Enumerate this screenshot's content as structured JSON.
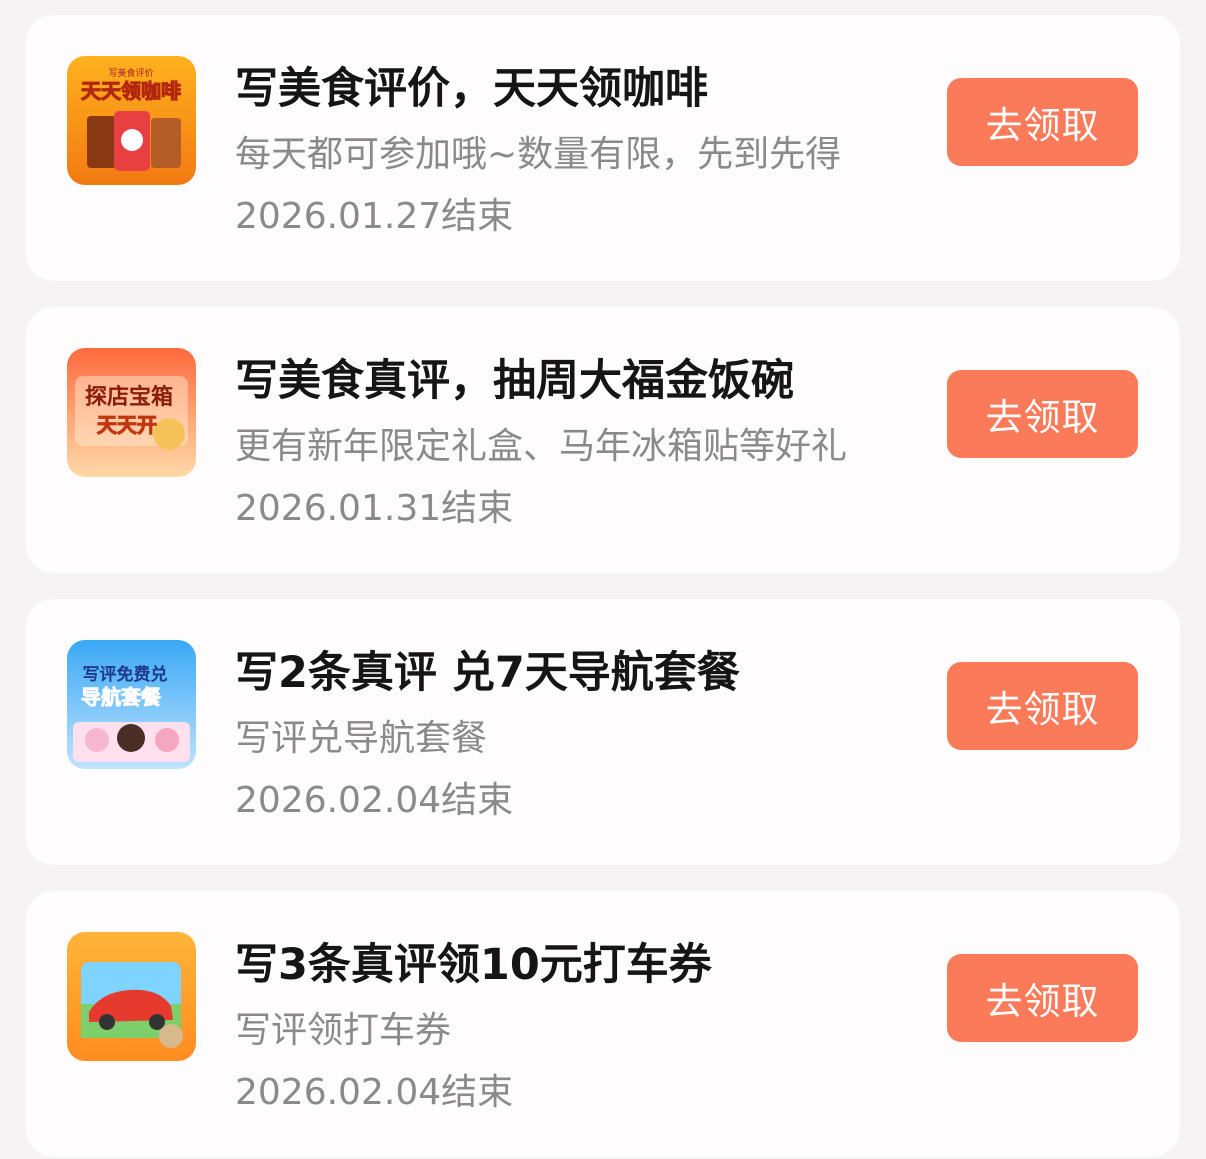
{
  "accent_color": "#fb7a5a",
  "tasks": [
    {
      "thumb_icon": "coffee-promo-thumbnail",
      "thumb_text": "天天领咖啡",
      "thumb_small": "写美食评价",
      "title": "写美食评价，天天领咖啡",
      "subtitle": "每天都可参加哦~数量有限，先到先得",
      "date": "2026.01.27结束",
      "button": "去领取"
    },
    {
      "thumb_icon": "treasure-box-thumbnail",
      "thumb_text": "探店宝箱",
      "thumb_text2": "天天开",
      "title": "写美食真评，抽周大福金饭碗",
      "subtitle": "更有新年限定礼盒、马年冰箱贴等好礼",
      "date": "2026.01.31结束",
      "button": "去领取"
    },
    {
      "thumb_icon": "navigation-package-thumbnail",
      "thumb_text": "写评免费兑",
      "thumb_text2": "导航套餐",
      "title": "写2条真评 兑7天导航套餐",
      "subtitle": "写评兑导航套餐",
      "date": "2026.02.04结束",
      "button": "去领取"
    },
    {
      "thumb_icon": "car-coupon-thumbnail",
      "title": "写3条真评领10元打车券",
      "subtitle": "写评领打车券",
      "date": "2026.02.04结束",
      "button": "去领取"
    }
  ]
}
